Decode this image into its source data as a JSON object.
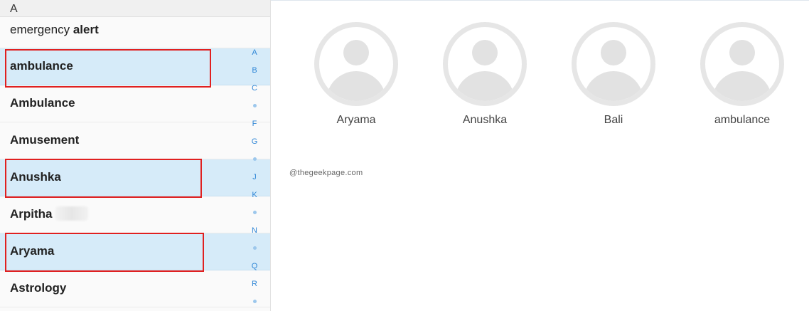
{
  "list": {
    "section_letter": "A",
    "rows": [
      {
        "prefix": "emergency ",
        "bold": "alert"
      },
      {
        "label": "ambulance"
      },
      {
        "label": "Ambulance"
      },
      {
        "label": "Amusement"
      },
      {
        "label": "Anushka"
      },
      {
        "label": "Arpitha"
      },
      {
        "label": "Aryama"
      },
      {
        "label": "Astrology"
      }
    ]
  },
  "index_strip": {
    "letters": [
      "A",
      "B",
      "C",
      "F",
      "G",
      "J",
      "K",
      "N",
      "Q",
      "R"
    ]
  },
  "detail": {
    "contacts": [
      {
        "name": "Aryama"
      },
      {
        "name": "Anushka"
      },
      {
        "name": "Bali"
      },
      {
        "name": "ambulance"
      }
    ],
    "watermark": "@thegeekpage.com"
  },
  "colors": {
    "selected_row": "#d6ebf9",
    "highlight_border": "#e02020",
    "index_letter": "#2f86d6"
  }
}
